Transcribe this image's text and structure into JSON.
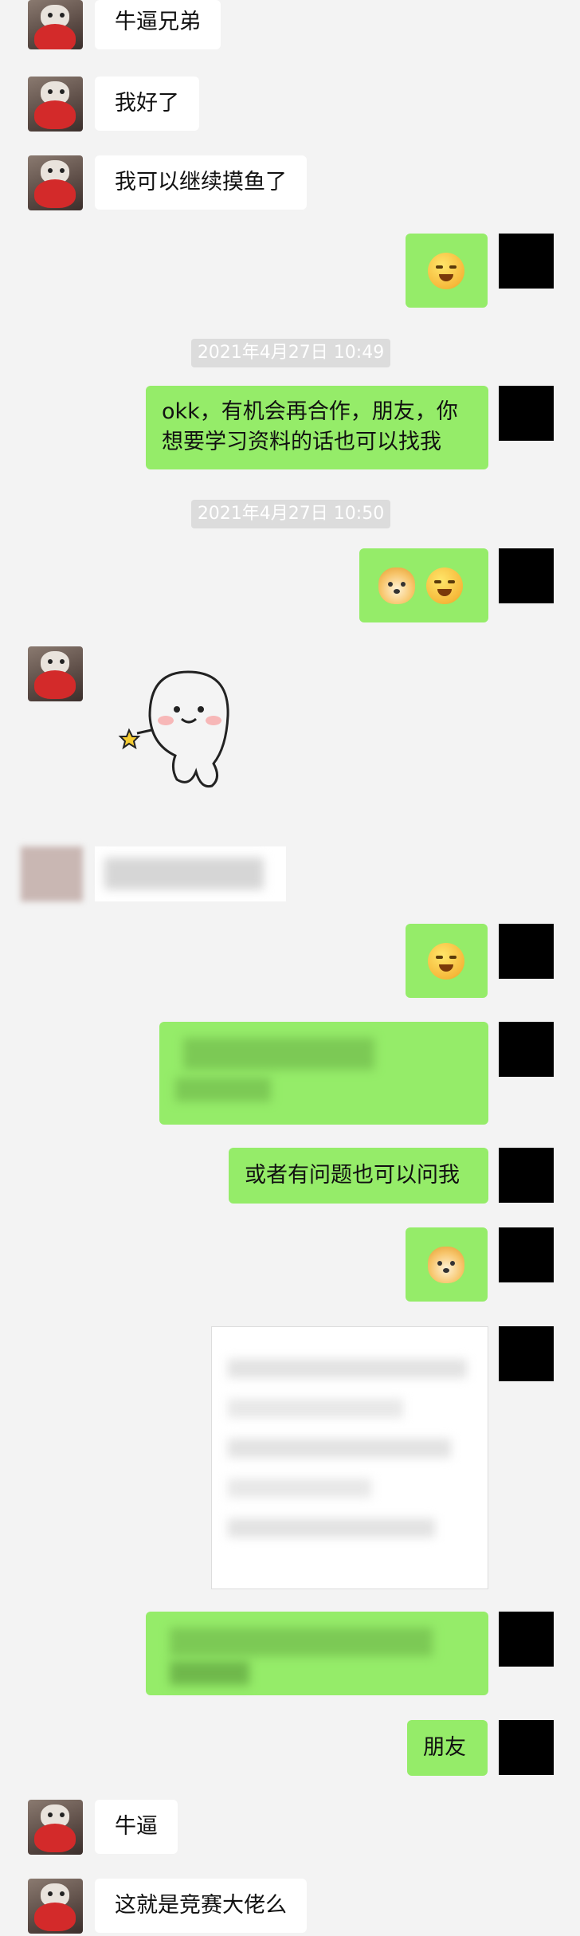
{
  "messages": {
    "m1": "牛逼兄弟",
    "m2": "我好了",
    "m3": "我可以继续摸鱼了",
    "m4_line1": "okk，有机会再合作，朋友，你",
    "m4_line2": "想要学习资料的话也可以找我",
    "m5": "或者有问题也可以问我",
    "m6": "朋友",
    "m7": "牛逼",
    "m8": "这就是竞赛大佬么"
  },
  "timestamps": {
    "t1": "2021年4月27日 10:49",
    "t2": "2021年4月27日 10:50"
  },
  "icons": {
    "laugh": "tears-of-joy-emoji",
    "doge": "doge-emoji",
    "sly": "sly-smile-emoji"
  },
  "colors": {
    "background": "#f3f3f3",
    "self_bubble": "#95ec69",
    "other_bubble": "#ffffff",
    "timestamp_bg": "#dcdcdc"
  }
}
